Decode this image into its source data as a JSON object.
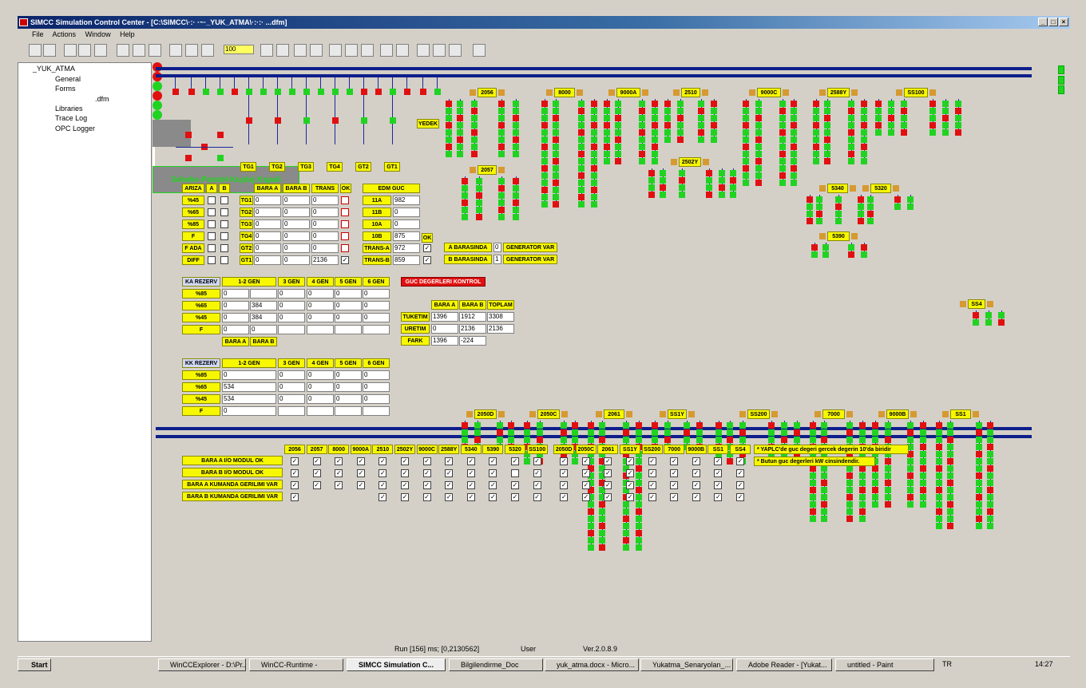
{
  "window": {
    "title": "SIMCC Simulation Control Center - [C:\\SIMCC\\·:· ·~·_YUK_ATMA\\·:·:· ...dfm]",
    "min": "_",
    "max": "□",
    "close": "×"
  },
  "menu": [
    "File",
    "Actions",
    "Window",
    "Help"
  ],
  "toolbar": {
    "zoom": "100"
  },
  "tree": {
    "root": "_YUK_ATMA",
    "general": "General",
    "forms": "Forms",
    "dfm": ".dfm",
    "libraries": "Libraries",
    "trace": "Trace Log",
    "opc": "OPC Logger"
  },
  "gens": [
    "TG1",
    "TG2",
    "TG3",
    "TG4",
    "GT2",
    "GT1"
  ],
  "yedek": "YEDEK",
  "subs": {
    "s2056": "2056",
    "s2057": "2057",
    "s8000": "8000",
    "s9000a": "9000A",
    "s2510": "2510",
    "s2502y": "2502Y",
    "s9000c": "9000C",
    "s2588y": "2588Y",
    "ss100": "SS100",
    "s5340": "5340",
    "s5320": "5320",
    "s5390": "5390",
    "ss4": "SS4",
    "s2050d": "2050D",
    "s2050c": "2050C",
    "s2061": "2061",
    "ss1y": "SS1Y",
    "ss200": "SS200",
    "s7000": "7000",
    "s9000b": "9000B",
    "ss1": "SS1"
  },
  "ariza": {
    "head": [
      "ARIZA",
      "A",
      "B"
    ],
    "rows": [
      "%45",
      "%65",
      "%85",
      "F",
      "F ADA",
      "DIFF"
    ]
  },
  "bara": {
    "head": [
      "BARA A",
      "BARA B",
      "TRANS",
      "OK"
    ],
    "rows": [
      {
        "n": "TG1",
        "a": "0",
        "b": "0",
        "t": "0"
      },
      {
        "n": "TG2",
        "a": "0",
        "b": "0",
        "t": "0"
      },
      {
        "n": "TG3",
        "a": "0",
        "b": "0",
        "t": "0"
      },
      {
        "n": "TG4",
        "a": "0",
        "b": "0",
        "t": "0"
      },
      {
        "n": "GT2",
        "a": "0",
        "b": "0",
        "t": "0"
      },
      {
        "n": "GT1",
        "a": "0",
        "b": "0",
        "t": "2136"
      }
    ]
  },
  "edm": {
    "head": "EDM GUC",
    "rows": [
      {
        "n": "11A",
        "v": "982"
      },
      {
        "n": "11B",
        "v": "0"
      },
      {
        "n": "10A",
        "v": "0"
      },
      {
        "n": "10B",
        "v": "875"
      },
      {
        "n": "TRANS-A",
        "v": "972"
      },
      {
        "n": "TRANS-B",
        "v": "859"
      }
    ],
    "ok": "OK"
  },
  "barasinda": {
    "a": "A BARASINDA",
    "b": "B BARASINDA",
    "av": "0",
    "bv": "1",
    "g1": "GENERATOR VAR",
    "g2": "GENERATOR VAR"
  },
  "sebeke": "Sebeke-Paralel-Kuplaj Kapali",
  "ka": {
    "head": [
      "KA REZERV",
      "1-2 GEN",
      "3 GEN",
      "4 GEN",
      "5 GEN",
      "6 GEN"
    ],
    "rows": [
      {
        "n": "%85",
        "v": [
          "0",
          "",
          "0",
          "0",
          "0",
          "0"
        ]
      },
      {
        "n": "%65",
        "v": [
          "0",
          "384",
          "0",
          "0",
          "0",
          "0"
        ]
      },
      {
        "n": "%45",
        "v": [
          "0",
          "384",
          "0",
          "0",
          "0",
          "0"
        ]
      },
      {
        "n": "F",
        "v": [
          "0",
          "0",
          "",
          "",
          "",
          ""
        ]
      }
    ],
    "foot": [
      "BARA A",
      "BARA B"
    ]
  },
  "kk": {
    "head": [
      "KK REZERV",
      "1-2 GEN",
      "3 GEN",
      "4 GEN",
      "5 GEN",
      "6 GEN"
    ],
    "rows": [
      {
        "n": "%85",
        "v": [
          "0",
          "0",
          "0",
          "0",
          "0"
        ]
      },
      {
        "n": "%65",
        "v": [
          "534",
          "0",
          "0",
          "0",
          "0"
        ]
      },
      {
        "n": "%45",
        "v": [
          "534",
          "0",
          "0",
          "0",
          "0"
        ]
      },
      {
        "n": "F",
        "v": [
          "0",
          "",
          "",
          "",
          ""
        ]
      }
    ]
  },
  "guc": {
    "btn": "GUC DEGERLERI KONTROL",
    "head": [
      "BARA A",
      "BARA B",
      "TOPLAM"
    ],
    "rows": [
      {
        "n": "TUKETIM",
        "v": [
          "1396",
          "1912",
          "3308"
        ]
      },
      {
        "n": "URETIM",
        "v": [
          "0",
          "2136",
          "2136"
        ]
      },
      {
        "n": "FARK",
        "v": [
          "1396",
          "-224",
          ""
        ]
      }
    ]
  },
  "io": {
    "cols": [
      "2056",
      "2057",
      "8000",
      "9000A",
      "2510",
      "2502Y",
      "9000C",
      "2588Y",
      "5340",
      "5390",
      "5320",
      "SS100",
      "2050D",
      "2050C",
      "2061",
      "SS1Y",
      "SS200",
      "7000",
      "9000B",
      "SS1",
      "SS4"
    ],
    "rows": [
      "BARA A I/O MODUL OK",
      "BARA B I/O MODUL OK",
      "BARA A KUMANDA GERILIMI VAR",
      "BARA B KUMANDA GERILIMI VAR"
    ]
  },
  "notes": [
    "* YAPLC'de guc degeri gercek degerin 10'da biridir",
    "* Butun guc degerleri kW cinsindendir."
  ],
  "status": {
    "run": "Run [156] ms; [0,2130562]",
    "user": "User",
    "ver": "Ver.2.0.8.9"
  },
  "taskbar": {
    "start": "Start",
    "tasks": [
      "WinCCExplorer - D:\\Pr...",
      "WinCC-Runtime -",
      "SIMCC Simulation C...",
      "Bilgilendirme_Doc",
      "yuk_atma.docx - Micro...",
      "Yukatma_Senaryolan_...",
      "Adobe Reader - [Yukat...",
      "untitled - Paint"
    ],
    "lang": "TR",
    "clock": "14:27"
  },
  "colors": {
    "bus": "#0e1e8a",
    "on": "#21d321",
    "off": "#e01010",
    "label": "#f7f700",
    "breaker": "#d69a30"
  }
}
